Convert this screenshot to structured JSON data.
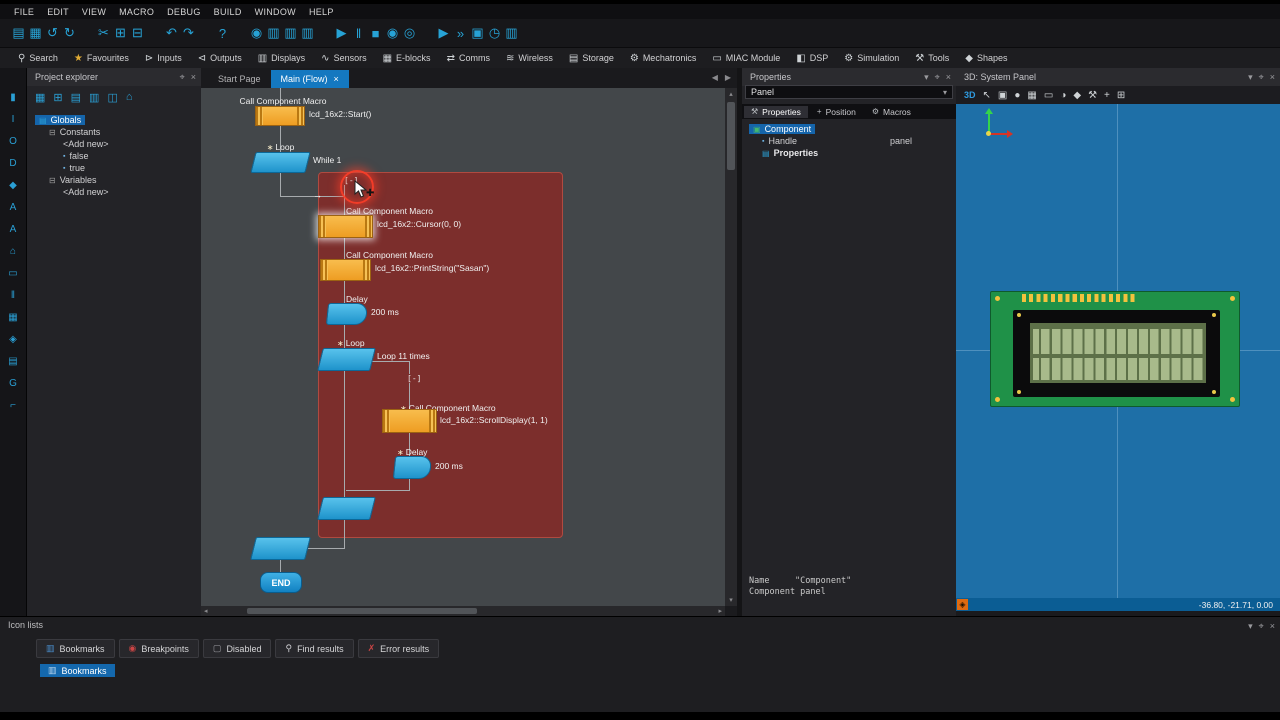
{
  "window_icons": {
    "collapse": "▾",
    "pin": "⌖",
    "close": "×",
    "tab_close": "×",
    "arrow_left": "◀",
    "arrow_right": "▶",
    "scroll_up": "▴",
    "scroll_down": "▾",
    "scroll_left": "◂",
    "scroll_right": "▸"
  },
  "menu": {
    "items": [
      "FILE",
      "EDIT",
      "VIEW",
      "MACRO",
      "DEBUG",
      "BUILD",
      "WINDOW",
      "HELP"
    ]
  },
  "toolbar": {
    "icons": [
      "▤",
      "▦",
      "↺",
      "↻",
      "",
      "✂",
      "⊞",
      "⊟",
      "",
      "↶",
      "↷",
      "",
      "?",
      "",
      "◉",
      "▥",
      "▥",
      "▥",
      "",
      "▶",
      "‖",
      "■",
      "◉",
      "◎",
      "",
      "▶",
      "»",
      "▣",
      "◷",
      "▥"
    ]
  },
  "ribbon": {
    "groups": [
      {
        "icon": "⚲",
        "label": "Search"
      },
      {
        "icon": "★",
        "label": "Favourites"
      },
      {
        "icon": "⊳",
        "label": "Inputs"
      },
      {
        "icon": "⊲",
        "label": "Outputs"
      },
      {
        "icon": "▥",
        "label": "Displays"
      },
      {
        "icon": "∿",
        "label": "Sensors"
      },
      {
        "icon": "▦",
        "label": "E-blocks"
      },
      {
        "icon": "⇄",
        "label": "Comms"
      },
      {
        "icon": "≋",
        "label": "Wireless"
      },
      {
        "icon": "▤",
        "label": "Storage"
      },
      {
        "icon": "⚙",
        "label": "Mechatronics"
      },
      {
        "icon": "▭",
        "label": "MIAC Module"
      },
      {
        "icon": "◧",
        "label": "DSP"
      },
      {
        "icon": "⚙",
        "label": "Simulation"
      },
      {
        "icon": "⚒",
        "label": "Tools"
      },
      {
        "icon": "◆",
        "label": "Shapes"
      }
    ]
  },
  "left_strip": {
    "icons": [
      "▮",
      "I",
      "O",
      "D",
      "◆",
      "A",
      "A",
      "⌂",
      "▭",
      "‖",
      "▦",
      "◈",
      "▤",
      "G",
      "⌐"
    ]
  },
  "project_explorer": {
    "title": "Project explorer",
    "toolbar_icons": [
      "▦",
      "⊞",
      "▤",
      "▥",
      "◫",
      "⌂"
    ],
    "globals_icon": "▤",
    "expander_icon": "⊟",
    "item_icon": "▪",
    "globals": "Globals",
    "constants": "Constants",
    "add_new_1": "<Add new>",
    "false_item": "false",
    "true_item": "true",
    "variables": "Variables",
    "add_new_2": "<Add new>"
  },
  "editor": {
    "tab_start": "Start Page",
    "tab_main": "Main (Flow)"
  },
  "flow": {
    "star": "∗",
    "collapse": "[-]",
    "insert_arrow": "→",
    "move_cursor": "✚",
    "call1_title": "Call Component Macro",
    "call1_detail": "lcd_16x2::Start()",
    "loop1_title": "Loop",
    "loop1_detail": "While 1",
    "call2_title": "Call Component Macro",
    "call2_detail": "lcd_16x2::Cursor(0, 0)",
    "call3_title": "Call Component Macro",
    "call3_detail": "lcd_16x2::PrintString(\"Sasan\")",
    "delay1_title": "Delay",
    "delay1_detail": "200 ms",
    "loop2_title": "Loop",
    "loop2_detail": "Loop 11 times",
    "call4_title": "Call Component Macro",
    "call4_detail": "lcd_16x2::ScrollDisplay(1, 1)",
    "delay2_title": "Delay",
    "delay2_detail": "200 ms",
    "end_label": "END"
  },
  "properties_panel": {
    "title": "Properties",
    "selector_value": "Panel",
    "tabs": [
      {
        "icon": "⚒",
        "label": "Properties"
      },
      {
        "icon": "+",
        "label": "Position"
      },
      {
        "icon": "⚙",
        "label": "Macros"
      }
    ],
    "component_icon": "▣",
    "handle_icon": "▪",
    "properties_icon": "▤",
    "tree_component": "Component",
    "tree_handle": "Handle",
    "tree_handle_value": "panel",
    "tree_properties": "Properties",
    "footer_name_label": "Name",
    "footer_name_value": "\"Component\"",
    "footer_type": "Component panel"
  },
  "panel_3d": {
    "title": "3D: System Panel",
    "toolbar_label": "3D",
    "toolbar_icons": [
      "↖",
      "▣",
      "●",
      "▦",
      "▭",
      "◑",
      "◆",
      "⚒",
      "+",
      "⊞"
    ],
    "status_icon": "◈",
    "status_coords": "-36.80, -21.71, 0.00"
  },
  "icon_lists": {
    "title": "Icon lists",
    "tabs": [
      {
        "icon": "▥",
        "label": "Bookmarks"
      },
      {
        "icon": "◉",
        "label": "Breakpoints"
      },
      {
        "icon": "▢",
        "label": "Disabled"
      },
      {
        "icon": "⚲",
        "label": "Find results"
      },
      {
        "icon": "✗",
        "label": "Error results"
      }
    ],
    "selected_icon": "▥",
    "selected_label": "Bookmarks"
  }
}
